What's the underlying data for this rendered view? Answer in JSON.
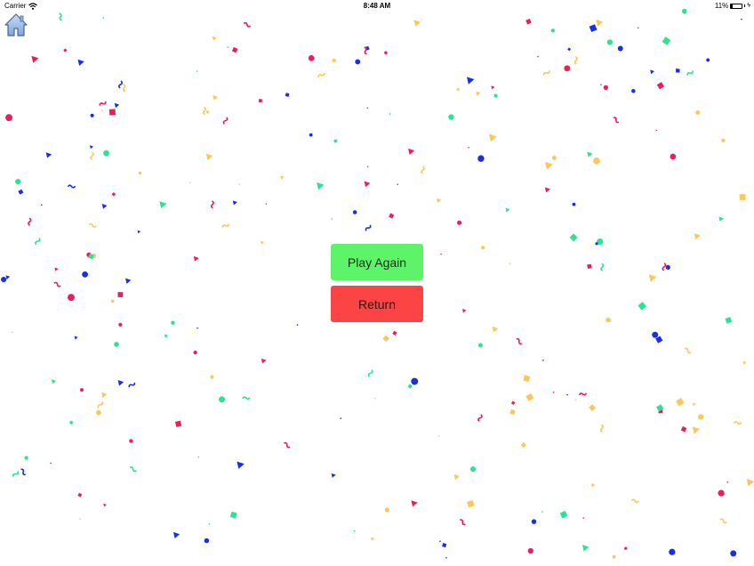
{
  "status_bar": {
    "carrier": "Carrier",
    "time": "8:48 AM",
    "battery_percent": "11%",
    "battery_level": 0.11
  },
  "home_button": {
    "icon": "home-icon"
  },
  "buttons": {
    "play_again": {
      "label": "Play Again",
      "color": "#5ef46a"
    },
    "return": {
      "label": "Return",
      "color": "#fc4444"
    }
  },
  "confetti_colors": [
    "#ef1b5a",
    "#1a2ee8",
    "#29e58f",
    "#fcc75a"
  ]
}
